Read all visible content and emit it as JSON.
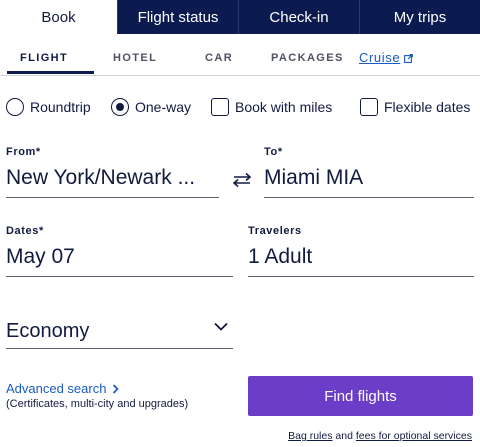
{
  "top_tabs": [
    "Book",
    "Flight status",
    "Check-in",
    "My trips"
  ],
  "sub_tabs": [
    "FLIGHT",
    "HOTEL",
    "CAR",
    "PACKAGES"
  ],
  "cruise_label": "Cruise",
  "trip_options": {
    "roundtrip": "Roundtrip",
    "oneway": "One-way",
    "miles": "Book with miles",
    "flexible": "Flexible dates",
    "selected": "One-way"
  },
  "from": {
    "label": "From*",
    "value": "New York/Newark ..."
  },
  "to": {
    "label": "To*",
    "value": "Miami MIA"
  },
  "dates": {
    "label": "Dates*",
    "value": "May 07"
  },
  "travelers": {
    "label": "Travelers",
    "value": "1 Adult"
  },
  "cabin": {
    "value": "Economy"
  },
  "advanced": {
    "label": "Advanced search",
    "sub": "(Certificates, multi-city and upgrades)"
  },
  "find_button": "Find flights",
  "footer": {
    "bag_rules": "Bag rules",
    "and": " and ",
    "fees": "fees for optional services"
  },
  "colors": {
    "navy": "#0b1b50",
    "primary_button": "#6c3dc8",
    "link": "#1a5bc4"
  }
}
